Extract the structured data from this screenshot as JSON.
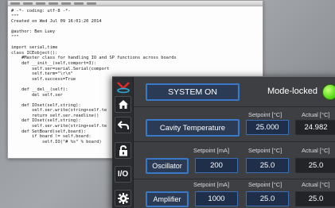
{
  "editor": {
    "code_lines": [
      "# -*- coding: utf-8 -*-",
      "\"\"\"",
      "Created on Wed Jul 09 16:01:20 2014",
      "",
      "@author: Ben Luey",
      "\"\"\"",
      "",
      "import serial,time",
      "class ICEobject():",
      "    #Master class for handling IO and SP functions across boards",
      "    def __init__(self,comport=3):",
      "        self.ser=serial.Serial(comport",
      "        self.term=\"\\r\\n\"",
      "        self.success=True",
      "",
      "    def __del__(self):",
      "        del self.ser",
      "",
      "    def IOset(self,string):",
      "        self.ser.write(string+self.te",
      "        return self.ser.readline()",
      "    def IOset(self,string):",
      "        self.ser.write(string+self.te",
      "    def SetBoard(self,board):",
      "        if board != self.board:",
      "            self.IO(\"# %s\" % board)"
    ]
  },
  "panel": {
    "system_button": "SYSTEM ON",
    "mode_label": "Mode-locked",
    "mode_color": "#5fe01e",
    "headers": {
      "setpoint_c": "Setpoint [°C]",
      "actual_c": "Actual [°C]",
      "setpoint_ma": "Setpoint [mA]"
    },
    "cavity": {
      "button": "Cavity Temperature",
      "setpoint": "25.000",
      "actual": "24.982"
    },
    "oscillator": {
      "button": "Oscillator",
      "current_setpoint": "200",
      "temp_setpoint": "25.0",
      "temp_actual": "25.0"
    },
    "amplifier": {
      "button": "Amplifier",
      "current_setpoint": "1000",
      "temp_setpoint": "25.0",
      "temp_actual": "25.0"
    }
  },
  "sidebar": {
    "icons": [
      "logo-icon",
      "home-icon",
      "back-icon",
      "lock-icon",
      "io-icon",
      "gear-icon"
    ],
    "io_label": "I/O"
  },
  "colors": {
    "accent_blue": "#3a78c8",
    "panel_bg": "#3e3f42",
    "led_green": "#5fe01e"
  }
}
